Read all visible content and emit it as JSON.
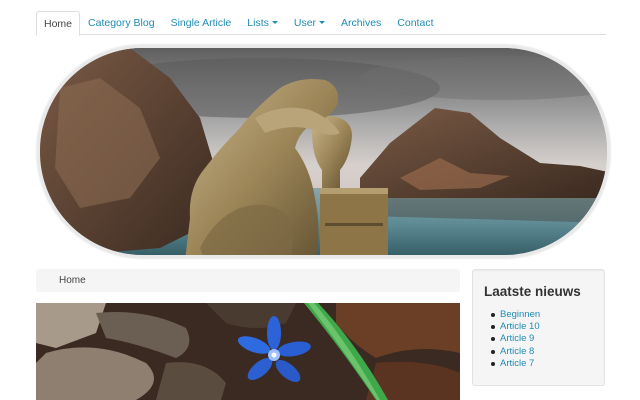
{
  "nav": {
    "items": [
      {
        "label": "Home"
      },
      {
        "label": "Category Blog"
      },
      {
        "label": "Single Article"
      },
      {
        "label": "Lists"
      },
      {
        "label": "User"
      },
      {
        "label": "Archives"
      },
      {
        "label": "Contact"
      }
    ]
  },
  "breadcrumb": {
    "home": "Home"
  },
  "sidebar": {
    "title": "Laatste nieuws",
    "items": [
      {
        "label": "Beginnen"
      },
      {
        "label": "Article 10"
      },
      {
        "label": "Article 9"
      },
      {
        "label": "Article 8"
      },
      {
        "label": "Article 7"
      }
    ]
  },
  "colors": {
    "link": "#1f8cb4",
    "module_bg": "#f5f5f5"
  }
}
